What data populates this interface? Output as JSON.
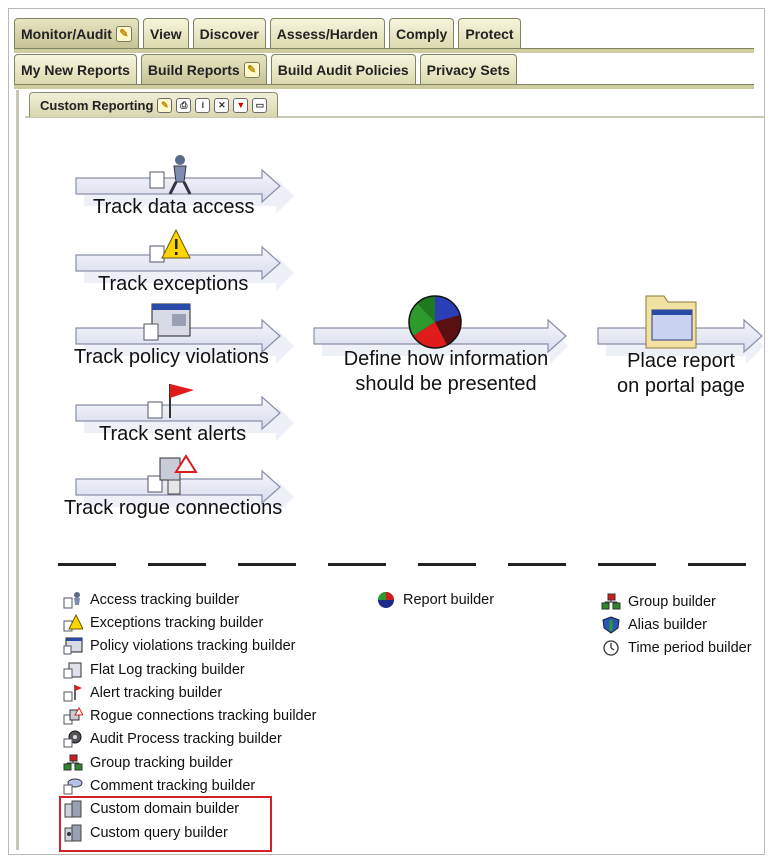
{
  "tabs_row1": [
    {
      "label": "Monitor/Audit",
      "has_icon": true,
      "active": true
    },
    {
      "label": "View",
      "has_icon": false,
      "active": false
    },
    {
      "label": "Discover",
      "has_icon": false,
      "active": false
    },
    {
      "label": "Assess/Harden",
      "has_icon": false,
      "active": false
    },
    {
      "label": "Comply",
      "has_icon": false,
      "active": false
    },
    {
      "label": "Protect",
      "has_icon": false,
      "active": false
    }
  ],
  "tabs_row2": [
    {
      "label": "My New Reports",
      "has_icon": false,
      "active": false
    },
    {
      "label": "Build Reports",
      "has_icon": true,
      "active": true
    },
    {
      "label": "Build Audit Policies",
      "has_icon": false,
      "active": false
    },
    {
      "label": "Privacy Sets",
      "has_icon": false,
      "active": false
    }
  ],
  "portlet": {
    "title": "Custom Reporting",
    "controls": [
      "edit-icon",
      "print-icon",
      "info-icon",
      "close-icon",
      "minimize-icon",
      "maximize-icon"
    ]
  },
  "flow": {
    "track_items": [
      {
        "label": "Track data access",
        "icon": "person-icon"
      },
      {
        "label": "Track exceptions",
        "icon": "warning-icon"
      },
      {
        "label": "Track policy violations",
        "icon": "window-icon"
      },
      {
        "label": "Track sent alerts",
        "icon": "flag-icon"
      },
      {
        "label": "Track rogue connections",
        "icon": "rogue-connection-icon"
      }
    ],
    "define_line1": "Define how information",
    "define_line2": "should be presented",
    "place_line1": "Place report",
    "place_line2": "on portal page"
  },
  "legend": {
    "col1": [
      {
        "label": "Access tracking builder",
        "icon": "person-icon"
      },
      {
        "label": "Exceptions tracking builder",
        "icon": "warning-icon"
      },
      {
        "label": "Policy violations tracking builder",
        "icon": "window-icon"
      },
      {
        "label": "Flat Log tracking builder",
        "icon": "document-icon"
      },
      {
        "label": "Alert tracking builder",
        "icon": "flag-icon"
      },
      {
        "label": "Rogue connections tracking builder",
        "icon": "rogue-connection-icon"
      },
      {
        "label": "Audit Process tracking builder",
        "icon": "process-icon"
      },
      {
        "label": "Group tracking builder",
        "icon": "group-icon"
      },
      {
        "label": "Comment tracking builder",
        "icon": "comment-icon"
      },
      {
        "label": "Custom domain builder",
        "icon": "custom-domain-icon"
      },
      {
        "label": "Custom query builder",
        "icon": "custom-query-icon"
      }
    ],
    "col2": [
      {
        "label": "Report builder",
        "icon": "pie-chart-icon"
      }
    ],
    "col3": [
      {
        "label": "Group builder",
        "icon": "group-icon"
      },
      {
        "label": "Alias builder",
        "icon": "shield-icon"
      },
      {
        "label": "Time period builder",
        "icon": "clock-icon"
      }
    ]
  },
  "colors": {
    "tab_bg": "#dcdab0",
    "highlight": "#d1212a",
    "arrow_fill": "#eceef6"
  }
}
